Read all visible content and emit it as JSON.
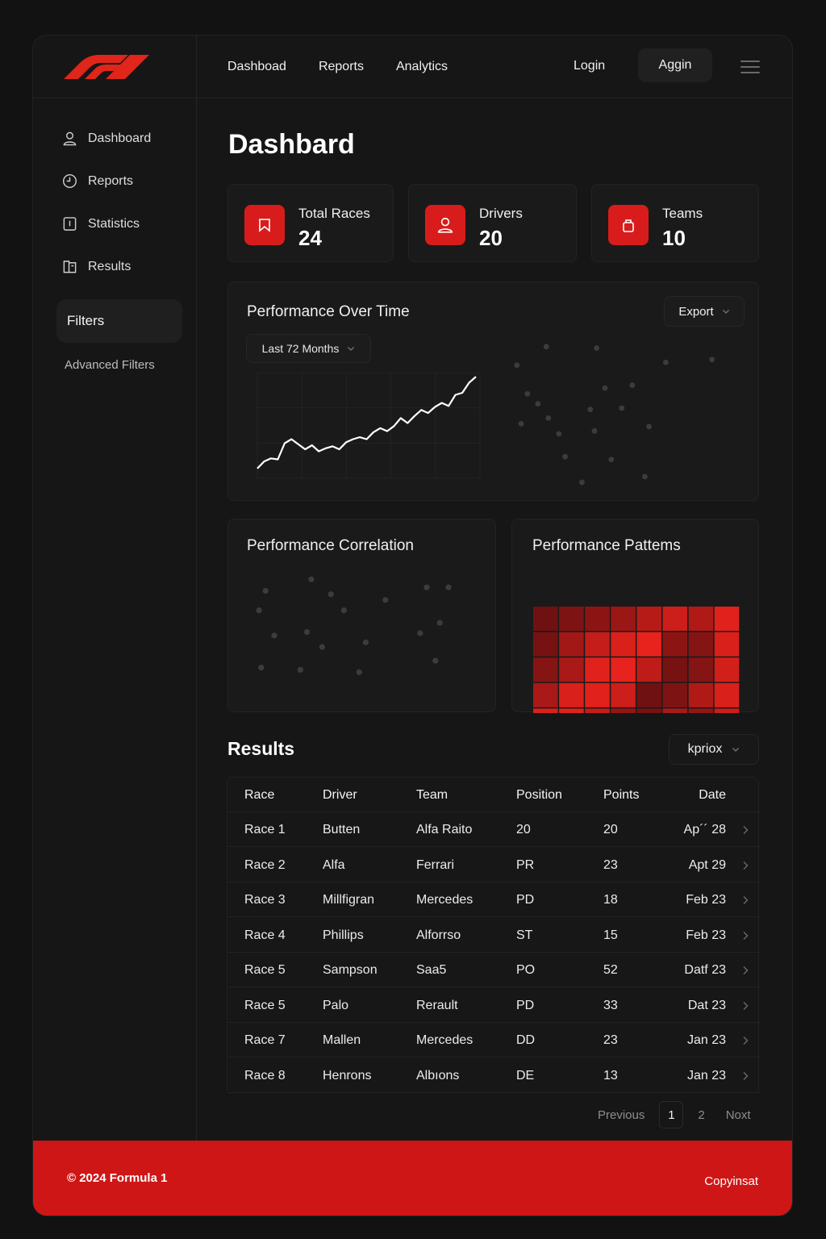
{
  "brand": {
    "logo": "F1",
    "accent": "#d81c1c"
  },
  "topbar": {
    "nav": [
      "Dashboad",
      "Reports",
      "Analytics"
    ],
    "login": "Login",
    "signup": "Aggin",
    "menu_icon": "hamburger-icon"
  },
  "sidebar": {
    "items": [
      {
        "label": "Dashboard",
        "icon": "user-icon"
      },
      {
        "label": "Reports",
        "icon": "clock-icon"
      },
      {
        "label": "Statistics",
        "icon": "panel-icon"
      },
      {
        "label": "Results",
        "icon": "document-icon"
      }
    ],
    "filters": "Filters",
    "advanced": "Advanced Filters"
  },
  "main": {
    "title": "Dashbard",
    "stats": [
      {
        "label": "Total Races",
        "value": "24",
        "icon": "flag-icon"
      },
      {
        "label": "Drivers",
        "value": "20",
        "icon": "driver-icon"
      },
      {
        "label": "Teams",
        "value": "10",
        "icon": "bag-icon"
      }
    ],
    "performance": {
      "title": "Performance Over Time",
      "export": "Export",
      "range": "Last 72 Months",
      "line": [
        0.05,
        0.12,
        0.15,
        0.14,
        0.3,
        0.34,
        0.29,
        0.24,
        0.28,
        0.22,
        0.25,
        0.27,
        0.24,
        0.31,
        0.34,
        0.36,
        0.34,
        0.41,
        0.45,
        0.42,
        0.47,
        0.55,
        0.5,
        0.57,
        0.63,
        0.6,
        0.66,
        0.7,
        0.67,
        0.78,
        0.8,
        0.9,
        0.96
      ],
      "scatter": [
        [
          0.03,
          0.14
        ],
        [
          0.17,
          0.01
        ],
        [
          0.96,
          0.1
        ],
        [
          0.18,
          0.51
        ],
        [
          0.4,
          0.6
        ],
        [
          0.23,
          0.62
        ],
        [
          0.48,
          0.8
        ],
        [
          0.05,
          0.55
        ],
        [
          0.66,
          0.57
        ],
        [
          0.08,
          0.34
        ],
        [
          0.38,
          0.45
        ],
        [
          0.53,
          0.44
        ],
        [
          0.13,
          0.41
        ],
        [
          0.58,
          0.28
        ],
        [
          0.45,
          0.3
        ],
        [
          0.74,
          0.12
        ],
        [
          0.26,
          0.78
        ],
        [
          0.64,
          0.92
        ],
        [
          0.41,
          0.02
        ],
        [
          0.34,
          0.96
        ]
      ]
    },
    "correlation": {
      "title": "Performance Correlation",
      "scatter": [
        [
          0.06,
          0.13
        ],
        [
          0.27,
          0.03
        ],
        [
          0.9,
          0.1
        ],
        [
          0.03,
          0.3
        ],
        [
          0.42,
          0.3
        ],
        [
          0.61,
          0.21
        ],
        [
          0.77,
          0.5
        ],
        [
          0.1,
          0.52
        ],
        [
          0.32,
          0.62
        ],
        [
          0.52,
          0.58
        ],
        [
          0.04,
          0.8
        ],
        [
          0.22,
          0.82
        ],
        [
          0.49,
          0.84
        ],
        [
          0.36,
          0.16
        ],
        [
          0.86,
          0.41
        ],
        [
          0.84,
          0.74
        ],
        [
          0.8,
          0.1
        ],
        [
          0.25,
          0.49
        ]
      ]
    },
    "patterns": {
      "title": "Performance Pattems",
      "grid": [
        [
          0.15,
          0.25,
          0.35,
          0.45,
          0.65,
          0.8,
          0.6,
          0.95
        ],
        [
          0.2,
          0.5,
          0.75,
          0.9,
          1.0,
          0.35,
          0.3,
          0.9
        ],
        [
          0.3,
          0.55,
          0.95,
          1.0,
          0.7,
          0.2,
          0.3,
          0.85
        ],
        [
          0.55,
          0.9,
          0.95,
          0.8,
          0.15,
          0.25,
          0.6,
          0.9
        ],
        [
          0.9,
          0.95,
          0.75,
          0.4,
          0.2,
          0.55,
          0.4,
          0.8
        ]
      ]
    }
  },
  "results": {
    "title": "Results",
    "sort": "kpriox",
    "columns": [
      "Race",
      "Driver",
      "Team",
      "Position",
      "Points",
      "Date"
    ],
    "rows": [
      [
        "Race 1",
        "Butten",
        "Alfa Raito",
        "20",
        "20",
        "Ap´´ 28"
      ],
      [
        "Race 2",
        "Alfa",
        "Ferrari",
        "PR",
        "23",
        "Apt 29"
      ],
      [
        "Race 3",
        "Millfigran",
        "Mercedes",
        "PD",
        "18",
        "Feb 23"
      ],
      [
        "Race 4",
        "Phillips",
        "Alforrso",
        "ST",
        "15",
        "Feb 23"
      ],
      [
        "Race 5",
        "Sampson",
        "Saa5",
        "PO",
        "52",
        "Datf 23"
      ],
      [
        "Race 5",
        "Palo",
        "Rerault",
        "PD",
        "33",
        "Dat 23"
      ],
      [
        "Race 7",
        "Mallen",
        "Mercedes",
        "DD",
        "23",
        "Jan 23"
      ],
      [
        "Race 8",
        "Henrons",
        "Albıons",
        "DE",
        "13",
        "Jan 23"
      ]
    ],
    "pager": {
      "previous": "Previous",
      "current": "1",
      "next_page": "2",
      "next": "Noxt"
    }
  },
  "footer": {
    "copyright": "© 2024 Formula 1",
    "right": "Copyinsat"
  }
}
